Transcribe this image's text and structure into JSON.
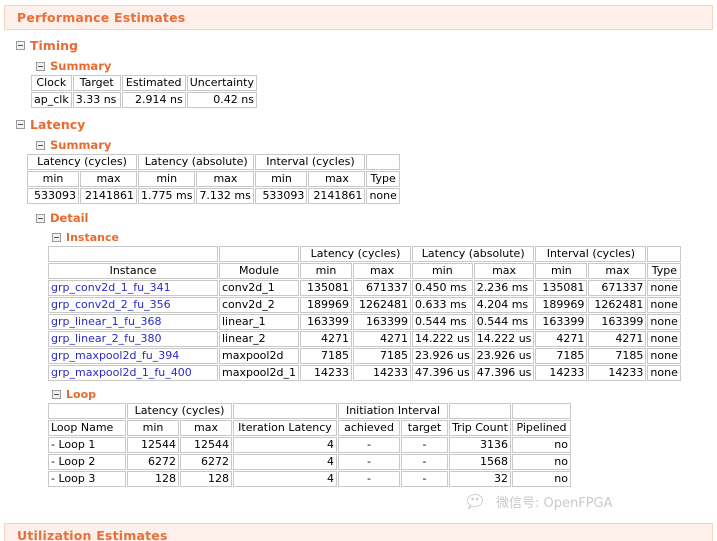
{
  "report": {
    "performance_header": "Performance Estimates",
    "utilization_header": "Utilization Estimates"
  },
  "tree": {
    "timing": "Timing",
    "timing_summary": "Summary",
    "latency": "Latency",
    "latency_summary": "Summary",
    "detail": "Detail",
    "instance": "Instance",
    "loop": "Loop"
  },
  "timing_summary": {
    "headers": [
      "Clock",
      "Target",
      "Estimated",
      "Uncertainty"
    ],
    "rows": [
      {
        "clock": "ap_clk",
        "target": "3.33 ns",
        "estimated": "2.914 ns",
        "uncertainty": "0.42 ns"
      }
    ]
  },
  "latency_summary": {
    "group_headers": [
      "",
      "Latency (cycles)",
      "Latency (absolute)",
      "Interval (cycles)",
      ""
    ],
    "sub_headers": [
      "min",
      "max",
      "min",
      "max",
      "min",
      "max",
      "Type"
    ],
    "row": {
      "lat_cycles_min": "533093",
      "lat_cycles_max": "2141861",
      "lat_abs_min": "1.775 ms",
      "lat_abs_max": "7.132 ms",
      "int_cycles_min": "533093",
      "int_cycles_max": "2141861",
      "type": "none"
    }
  },
  "instance_table": {
    "group_headers": [
      "",
      "",
      "Latency (cycles)",
      "Latency (absolute)",
      "Interval (cycles)",
      ""
    ],
    "sub_headers": [
      "Instance",
      "Module",
      "min",
      "max",
      "min",
      "max",
      "min",
      "max",
      "Type"
    ],
    "rows": [
      {
        "instance": "grp_conv2d_1_fu_341",
        "module": "conv2d_1",
        "lat_cycles_min": "135081",
        "lat_cycles_max": "671337",
        "lat_abs_min": "0.450 ms",
        "lat_abs_max": "2.236 ms",
        "int_cycles_min": "135081",
        "int_cycles_max": "671337",
        "type": "none"
      },
      {
        "instance": "grp_conv2d_2_fu_356",
        "module": "conv2d_2",
        "lat_cycles_min": "189969",
        "lat_cycles_max": "1262481",
        "lat_abs_min": "0.633 ms",
        "lat_abs_max": "4.204 ms",
        "int_cycles_min": "189969",
        "int_cycles_max": "1262481",
        "type": "none"
      },
      {
        "instance": "grp_linear_1_fu_368",
        "module": "linear_1",
        "lat_cycles_min": "163399",
        "lat_cycles_max": "163399",
        "lat_abs_min": "0.544 ms",
        "lat_abs_max": "0.544 ms",
        "int_cycles_min": "163399",
        "int_cycles_max": "163399",
        "type": "none"
      },
      {
        "instance": "grp_linear_2_fu_380",
        "module": "linear_2",
        "lat_cycles_min": "4271",
        "lat_cycles_max": "4271",
        "lat_abs_min": "14.222 us",
        "lat_abs_max": "14.222 us",
        "int_cycles_min": "4271",
        "int_cycles_max": "4271",
        "type": "none"
      },
      {
        "instance": "grp_maxpool2d_fu_394",
        "module": "maxpool2d",
        "lat_cycles_min": "7185",
        "lat_cycles_max": "7185",
        "lat_abs_min": "23.926 us",
        "lat_abs_max": "23.926 us",
        "int_cycles_min": "7185",
        "int_cycles_max": "7185",
        "type": "none"
      },
      {
        "instance": "grp_maxpool2d_1_fu_400",
        "module": "maxpool2d_1",
        "lat_cycles_min": "14233",
        "lat_cycles_max": "14233",
        "lat_abs_min": "47.396 us",
        "lat_abs_max": "47.396 us",
        "int_cycles_min": "14233",
        "int_cycles_max": "14233",
        "type": "none"
      }
    ]
  },
  "loop_table": {
    "group_headers": [
      "",
      "Latency (cycles)",
      "",
      "Initiation Interval",
      "",
      ""
    ],
    "sub_headers": [
      "Loop Name",
      "min",
      "max",
      "Iteration Latency",
      "achieved",
      "target",
      "Trip Count",
      "Pipelined"
    ],
    "rows": [
      {
        "name": "- Loop 1",
        "lat_min": "12544",
        "lat_max": "12544",
        "iter_latency": "4",
        "ii_achieved": "-",
        "ii_target": "-",
        "trip_count": "3136",
        "pipelined": "no"
      },
      {
        "name": "- Loop 2",
        "lat_min": "6272",
        "lat_max": "6272",
        "iter_latency": "4",
        "ii_achieved": "-",
        "ii_target": "-",
        "trip_count": "1568",
        "pipelined": "no"
      },
      {
        "name": "- Loop 3",
        "lat_min": "128",
        "lat_max": "128",
        "iter_latency": "4",
        "ii_achieved": "-",
        "ii_target": "-",
        "trip_count": "32",
        "pipelined": "no"
      }
    ]
  },
  "watermark": {
    "text": "微信号: OpenFPGA"
  },
  "colors": {
    "accent": "#ea6a2e",
    "panel_bg": "#fdf0ea",
    "panel_border": "#f3d5c6",
    "link": "#2a2acc",
    "cell_border": "#c8c8c8"
  }
}
